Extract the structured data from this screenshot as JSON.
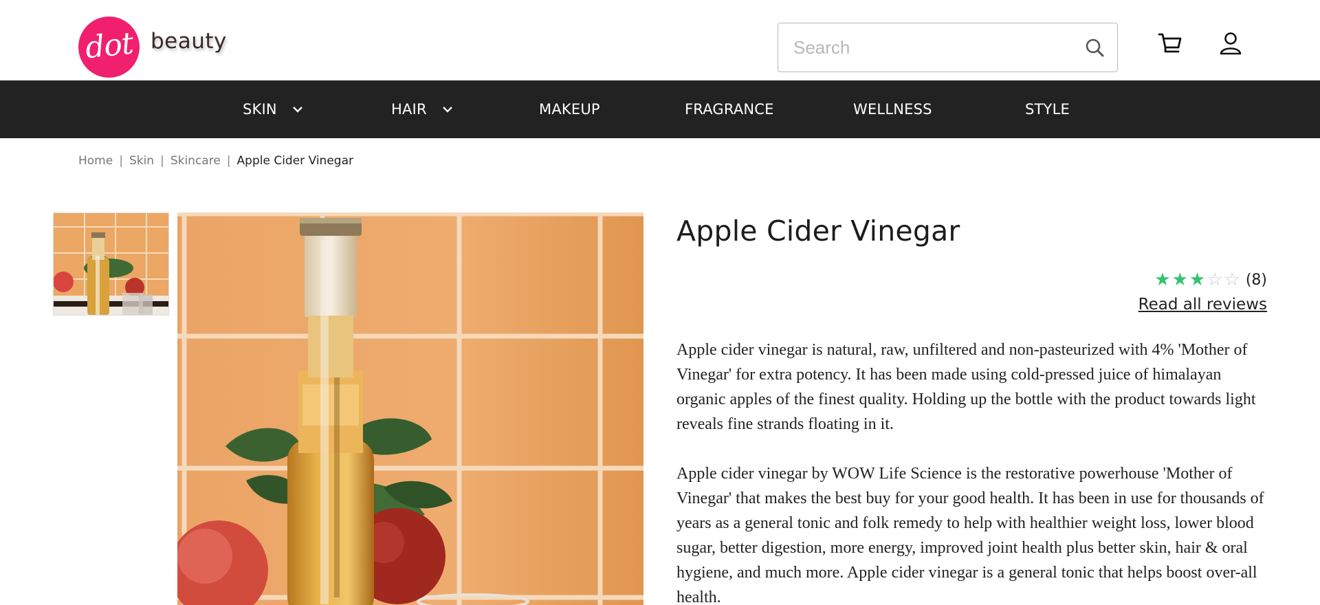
{
  "brand": {
    "logo_mark": "dot",
    "logo_word": "beauty",
    "accent": "#f0206f"
  },
  "search": {
    "placeholder": "Search",
    "value": ""
  },
  "icons": {
    "search": "search-icon",
    "cart": "cart-icon",
    "account": "user-icon",
    "dropdown": "chevron-down-icon",
    "star": "star-icon"
  },
  "nav": {
    "background": "#222222",
    "items": [
      {
        "label": "SKIN",
        "has_dropdown": true
      },
      {
        "label": "HAIR",
        "has_dropdown": true
      },
      {
        "label": "MAKEUP",
        "has_dropdown": false
      },
      {
        "label": "FRAGRANCE",
        "has_dropdown": false
      },
      {
        "label": "WELLNESS",
        "has_dropdown": false
      },
      {
        "label": "STYLE",
        "has_dropdown": false
      }
    ]
  },
  "breadcrumb": {
    "items": [
      "Home",
      "Skin",
      "Skincare",
      "Apple Cider Vinegar"
    ],
    "separator": "|"
  },
  "product": {
    "title": "Apple Cider Vinegar",
    "rating": {
      "value": 3,
      "max": 5,
      "count_label": "(8)",
      "star_color": "#34c26f"
    },
    "read_reviews_label": "Read all reviews",
    "description": [
      "Apple cider vinegar is natural, raw, unfiltered and non-pasteurized with 4% 'Mother of Vinegar' for extra potency. It has been made using cold-pressed juice of himalayan organic apples of the finest quality. Holding up the bottle with the product towards light reveals fine strands floating in it.",
      "Apple cider vinegar by WOW Life Science is the restorative powerhouse 'Mother of Vinegar' that makes the best buy for your good health. It has been in use for thousands of years as a general tonic and folk remedy to help with healthier weight loss, lower blood sugar, better digestion, more energy, improved joint health plus better skin, hair & oral hygiene, and much more. Apple cider vinegar is a general tonic that helps boost over-all health."
    ]
  }
}
